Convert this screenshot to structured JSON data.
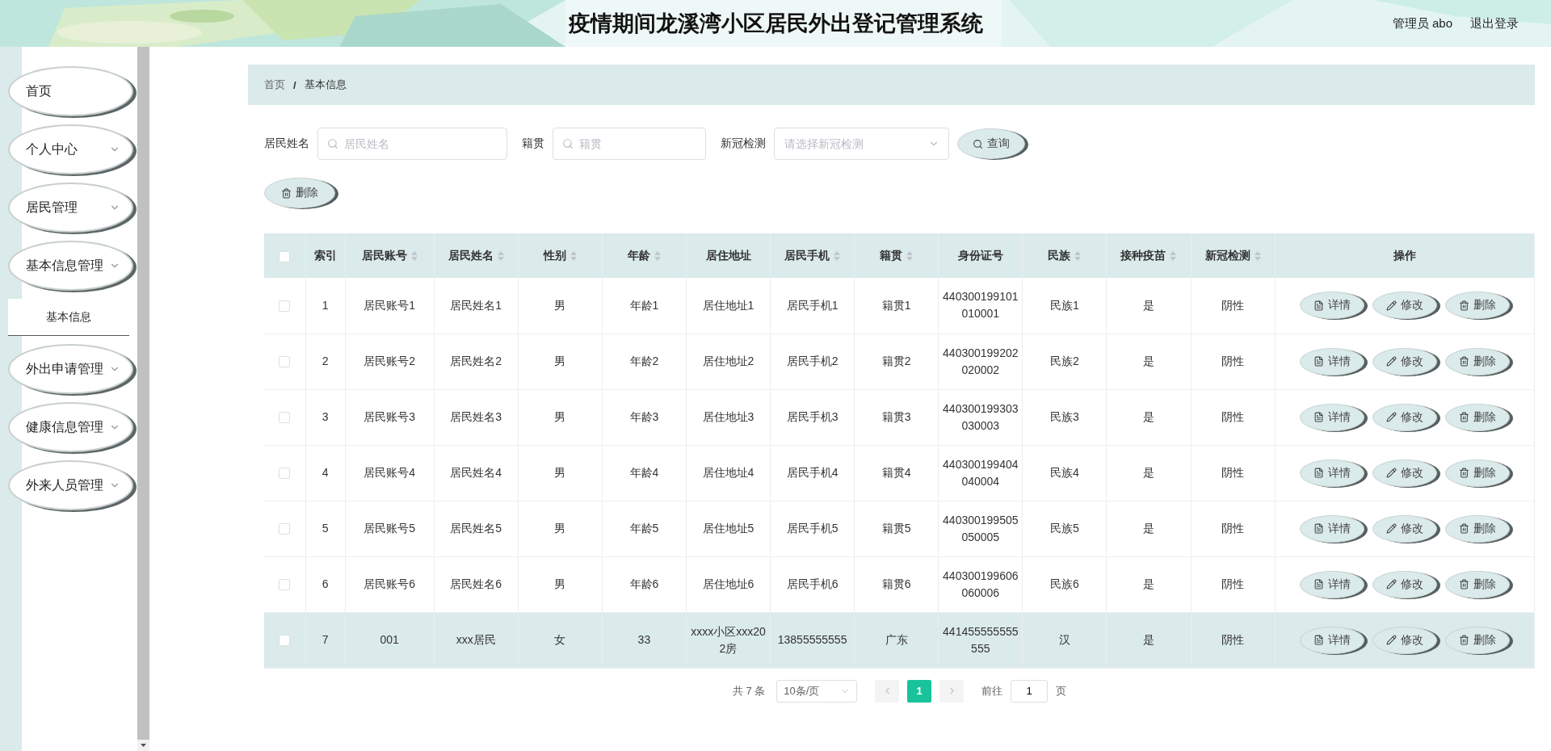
{
  "header": {
    "title": "疫情期间龙溪湾小区居民外出登记管理系统",
    "user": "管理员 abo",
    "logout": "退出登录"
  },
  "sidebar": {
    "items": [
      {
        "label": "首页",
        "expandable": false
      },
      {
        "label": "个人中心",
        "expandable": true
      },
      {
        "label": "居民管理",
        "expandable": true
      },
      {
        "label": "基本信息管理",
        "expandable": true,
        "children": [
          {
            "label": "基本信息"
          }
        ]
      },
      {
        "label": "外出申请管理",
        "expandable": true
      },
      {
        "label": "健康信息管理",
        "expandable": true
      },
      {
        "label": "外来人员管理",
        "expandable": true
      }
    ]
  },
  "breadcrumb": [
    {
      "label": "首页",
      "current": false
    },
    {
      "label": "基本信息",
      "current": true
    }
  ],
  "breadcrumb_separator": "/",
  "search": {
    "fields": [
      {
        "kind": "text",
        "label": "居民姓名",
        "placeholder": "居民姓名"
      },
      {
        "kind": "text",
        "label": "籍贯",
        "placeholder": "籍贯"
      },
      {
        "kind": "select",
        "label": "新冠检测",
        "placeholder": "请选择新冠检测"
      }
    ],
    "button": "查询"
  },
  "toolbar": {
    "delete": "删除"
  },
  "table": {
    "all_checked": false,
    "columns": [
      {
        "label": "索引",
        "sortable": false
      },
      {
        "label": "居民账号",
        "sortable": true
      },
      {
        "label": "居民姓名",
        "sortable": true
      },
      {
        "label": "性别",
        "sortable": true
      },
      {
        "label": "年龄",
        "sortable": true
      },
      {
        "label": "居住地址",
        "sortable": false
      },
      {
        "label": "居民手机",
        "sortable": true
      },
      {
        "label": "籍贯",
        "sortable": true
      },
      {
        "label": "身份证号",
        "sortable": false
      },
      {
        "label": "民族",
        "sortable": true
      },
      {
        "label": "接种疫苗",
        "sortable": true
      },
      {
        "label": "新冠检测",
        "sortable": true
      },
      {
        "label": "操作",
        "sortable": false
      }
    ],
    "rows": [
      {
        "checked": false,
        "highlighted": false,
        "cells": [
          "1",
          "居民账号1",
          "居民姓名1",
          "男",
          "年龄1",
          "居住地址1",
          "居民手机1",
          "籍贯1",
          "440300199101010001",
          "民族1",
          "是",
          "阴性"
        ],
        "actions": [
          "详情",
          "修改",
          "删除"
        ]
      },
      {
        "checked": false,
        "highlighted": false,
        "cells": [
          "2",
          "居民账号2",
          "居民姓名2",
          "男",
          "年龄2",
          "居住地址2",
          "居民手机2",
          "籍贯2",
          "440300199202020002",
          "民族2",
          "是",
          "阴性"
        ],
        "actions": [
          "详情",
          "修改",
          "删除"
        ]
      },
      {
        "checked": false,
        "highlighted": false,
        "cells": [
          "3",
          "居民账号3",
          "居民姓名3",
          "男",
          "年龄3",
          "居住地址3",
          "居民手机3",
          "籍贯3",
          "440300199303030003",
          "民族3",
          "是",
          "阴性"
        ],
        "actions": [
          "详情",
          "修改",
          "删除"
        ]
      },
      {
        "checked": false,
        "highlighted": false,
        "cells": [
          "4",
          "居民账号4",
          "居民姓名4",
          "男",
          "年龄4",
          "居住地址4",
          "居民手机4",
          "籍贯4",
          "440300199404040004",
          "民族4",
          "是",
          "阴性"
        ],
        "actions": [
          "详情",
          "修改",
          "删除"
        ]
      },
      {
        "checked": false,
        "highlighted": false,
        "cells": [
          "5",
          "居民账号5",
          "居民姓名5",
          "男",
          "年龄5",
          "居住地址5",
          "居民手机5",
          "籍贯5",
          "440300199505050005",
          "民族5",
          "是",
          "阴性"
        ],
        "actions": [
          "详情",
          "修改",
          "删除"
        ]
      },
      {
        "checked": false,
        "highlighted": false,
        "cells": [
          "6",
          "居民账号6",
          "居民姓名6",
          "男",
          "年龄6",
          "居住地址6",
          "居民手机6",
          "籍贯6",
          "440300199606060006",
          "民族6",
          "是",
          "阴性"
        ],
        "actions": [
          "详情",
          "修改",
          "删除"
        ]
      },
      {
        "checked": false,
        "highlighted": true,
        "cells": [
          "7",
          "001",
          "xxx居民",
          "女",
          "33",
          "xxxx小区xxx202房",
          "13855555555",
          "广东",
          "441455555555555",
          "汉",
          "是",
          "阴性"
        ],
        "actions": [
          "详情",
          "修改",
          "删除"
        ]
      }
    ]
  },
  "pagination": {
    "total": "共 7 条",
    "page_size": "10条/页",
    "pages": [
      {
        "label": "1",
        "selected": true
      }
    ],
    "goto_label": "前往",
    "goto_value": "1",
    "goto_suffix": "页"
  }
}
